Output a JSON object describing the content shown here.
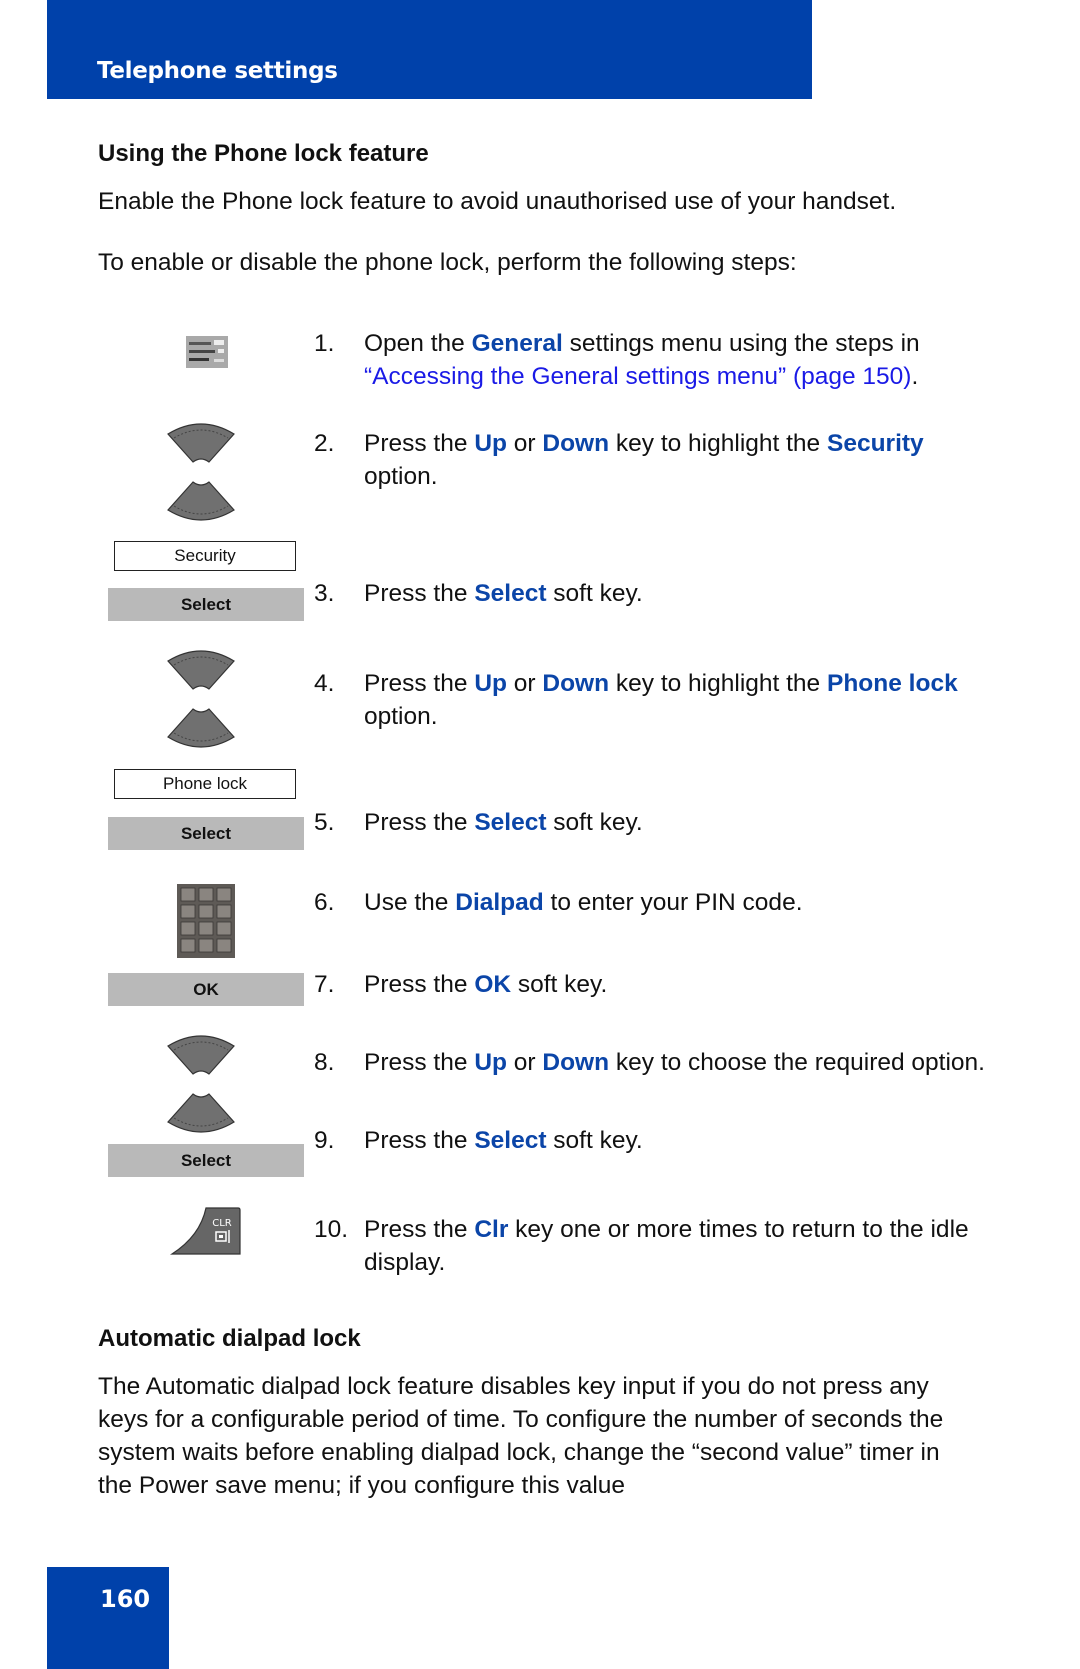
{
  "header": {
    "title": "Telephone settings"
  },
  "section1": {
    "title": "Using the Phone lock feature",
    "intro": "Enable the Phone lock feature to avoid unauthorised use of your handset.",
    "lead": "To enable or disable the phone lock, perform the following steps:"
  },
  "steps": [
    {
      "num": "1.",
      "parts": [
        {
          "t": "Open the ",
          "s": "n"
        },
        {
          "t": "General",
          "s": "k"
        },
        {
          "t": " settings menu using the steps in ",
          "s": "n"
        },
        {
          "t": "“Accessing the General settings menu” (page 150)",
          "s": "l"
        },
        {
          "t": ".",
          "s": "n"
        }
      ]
    },
    {
      "num": "2.",
      "parts": [
        {
          "t": "Press the ",
          "s": "n"
        },
        {
          "t": "Up",
          "s": "k"
        },
        {
          "t": " or ",
          "s": "n"
        },
        {
          "t": "Down",
          "s": "k"
        },
        {
          "t": " key to highlight the ",
          "s": "n"
        },
        {
          "t": "Security",
          "s": "k"
        },
        {
          "t": " option.",
          "s": "n"
        }
      ]
    },
    {
      "num": "3.",
      "parts": [
        {
          "t": "Press the ",
          "s": "n"
        },
        {
          "t": "Select",
          "s": "k"
        },
        {
          "t": " soft key.",
          "s": "n"
        }
      ]
    },
    {
      "num": "4.",
      "parts": [
        {
          "t": "Press the ",
          "s": "n"
        },
        {
          "t": "Up",
          "s": "k"
        },
        {
          "t": " or ",
          "s": "n"
        },
        {
          "t": "Down",
          "s": "k"
        },
        {
          "t": " key to highlight the ",
          "s": "n"
        },
        {
          "t": "Phone lock",
          "s": "k"
        },
        {
          "t": " option.",
          "s": "n"
        }
      ]
    },
    {
      "num": "5.",
      "parts": [
        {
          "t": "Press the ",
          "s": "n"
        },
        {
          "t": "Select",
          "s": "k"
        },
        {
          "t": " soft key.",
          "s": "n"
        }
      ]
    },
    {
      "num": "6.",
      "parts": [
        {
          "t": "Use the ",
          "s": "n"
        },
        {
          "t": "Dialpad",
          "s": "k"
        },
        {
          "t": " to enter your PIN code.",
          "s": "n"
        }
      ]
    },
    {
      "num": "7.",
      "parts": [
        {
          "t": "Press the ",
          "s": "n"
        },
        {
          "t": "OK",
          "s": "k"
        },
        {
          "t": " soft key.",
          "s": "n"
        }
      ]
    },
    {
      "num": "8.",
      "parts": [
        {
          "t": "Press the ",
          "s": "n"
        },
        {
          "t": "Up",
          "s": "k"
        },
        {
          "t": " or ",
          "s": "n"
        },
        {
          "t": "Down",
          "s": "k"
        },
        {
          "t": " key to choose the required option.",
          "s": "n"
        }
      ]
    },
    {
      "num": "9.",
      "parts": [
        {
          "t": "Press the ",
          "s": "n"
        },
        {
          "t": "Select",
          "s": "k"
        },
        {
          "t": " soft key.",
          "s": "n"
        }
      ]
    },
    {
      "num": "10.",
      "parts": [
        {
          "t": "Press the ",
          "s": "n"
        },
        {
          "t": "Clr",
          "s": "k"
        },
        {
          "t": " key one or more times to return to the idle display.",
          "s": "n"
        }
      ]
    }
  ],
  "illustrations": {
    "screen_security": "Security",
    "softkey_select": "Select",
    "screen_phone_lock": "Phone lock",
    "softkey_ok": "OK",
    "clr_key_label": "CLR"
  },
  "section2": {
    "title": "Automatic dialpad lock",
    "body": "The Automatic dialpad lock feature disables key input if you do not press any keys for a configurable period of time. To configure the number of seconds the system waits before enabling dialpad lock, change the “second value” timer in the Power save menu; if you configure this value"
  },
  "footer": {
    "page_number": "160"
  },
  "colors": {
    "brand_blue": "#0041aa",
    "keyword_blue": "#0b45a8",
    "link_blue": "#1a1ae6",
    "softkey_gray": "#b9b9b9"
  }
}
